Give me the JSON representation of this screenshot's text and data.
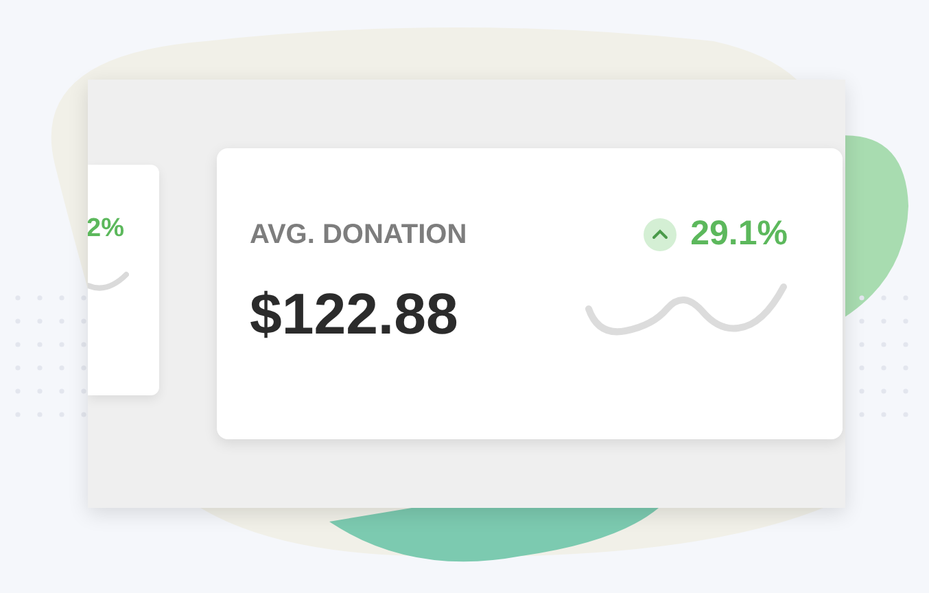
{
  "cards": [
    {
      "kind": "partial",
      "change": "2%"
    },
    {
      "kind": "full",
      "label": "AVG. DONATION",
      "value": "$122.88",
      "change": "29.1%"
    }
  ]
}
